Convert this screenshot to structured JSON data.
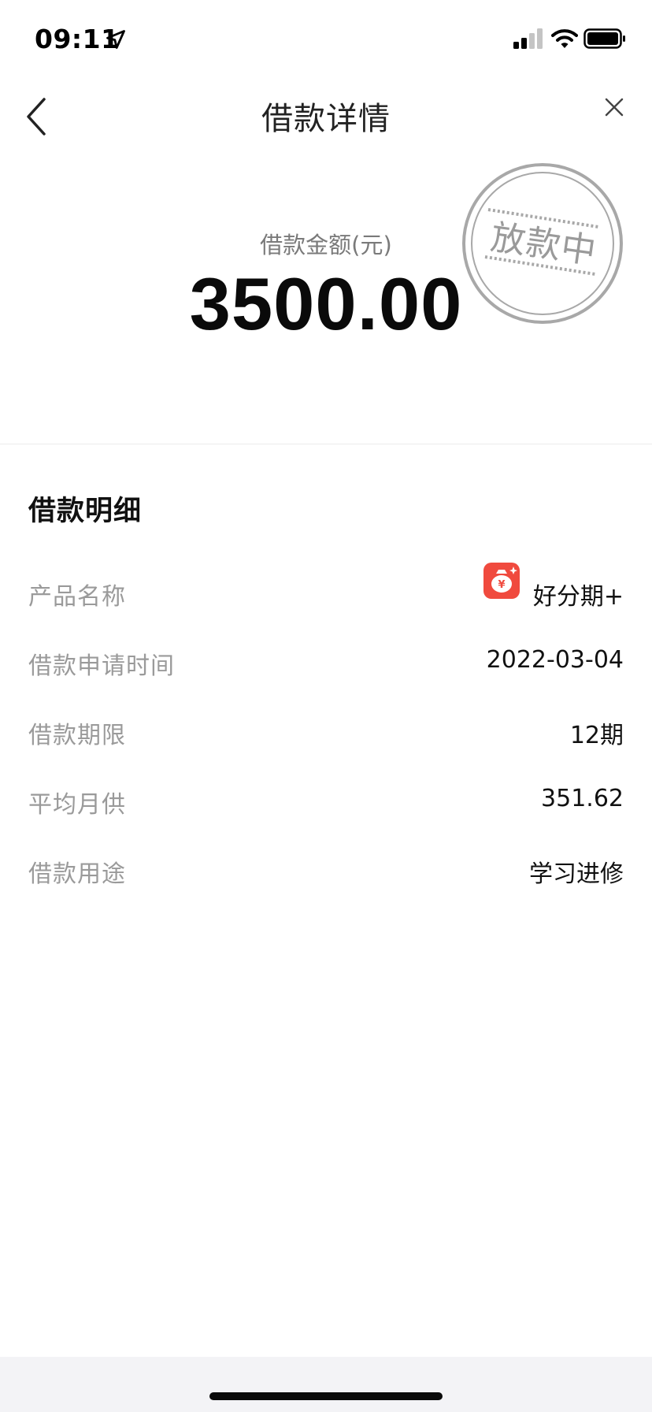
{
  "status_bar": {
    "time": "09:11"
  },
  "nav": {
    "title": "借款详情"
  },
  "amount": {
    "label": "借款金额(元)",
    "value": "3500.00",
    "status_stamp": "放款中"
  },
  "details": {
    "title": "借款明细",
    "rows": [
      {
        "label": "产品名称",
        "value": "好分期+"
      },
      {
        "label": "借款申请时间",
        "value": "2022-03-04"
      },
      {
        "label": "借款期限",
        "value": "12期"
      },
      {
        "label": "平均月供",
        "value": "351.62"
      },
      {
        "label": "借款用途",
        "value": "学习进修"
      }
    ]
  },
  "colors": {
    "product_icon": "#f04a3e",
    "stamp": "#9a9a9a",
    "label_gray": "#9a9a9a",
    "bottom_bar": "#f3f3f6"
  }
}
